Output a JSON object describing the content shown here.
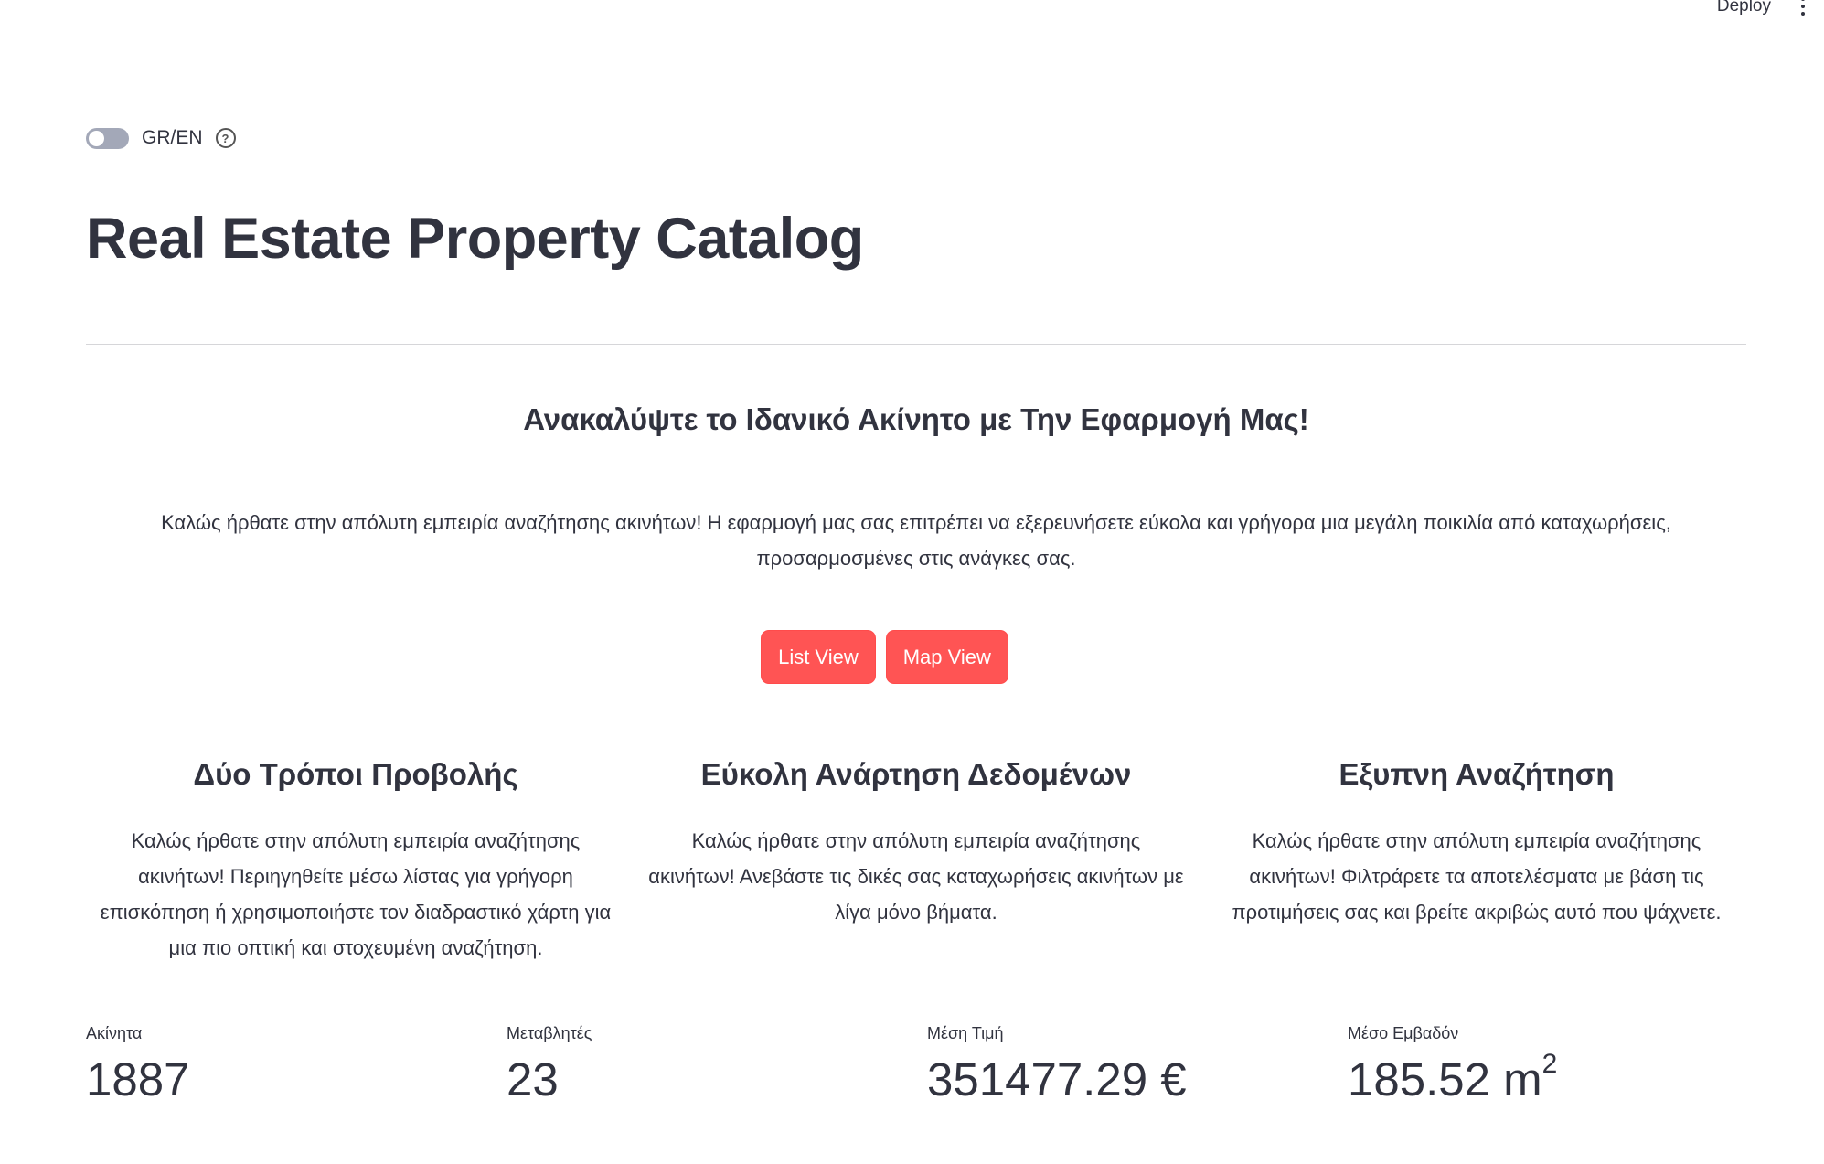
{
  "header": {
    "deploy_label": "Deploy",
    "menu_icon": "kebab-menu-icon"
  },
  "lang_toggle": {
    "label": "GR/EN",
    "checked": false,
    "help_icon": "question-circle-icon"
  },
  "page": {
    "title": "Real Estate Property Catalog"
  },
  "intro": {
    "subtitle": "Ανακαλύψτε το Ιδανικό Ακίνητο με Την Εφαρμογή Μας!",
    "text": "Καλώς ήρθατε στην απόλυτη εμπειρία αναζήτησης ακινήτων! Η εφαρμογή μας σας επιτρέπει να εξερευνήσετε εύκολα και γρήγορα μια μεγάλη ποικιλία από καταχωρήσεις, προσαρμοσμένες στις ανάγκες σας."
  },
  "buttons": {
    "list_view": "List View",
    "map_view": "Map View",
    "color": "#ff5454"
  },
  "features": [
    {
      "title": "Δύο Τρόποι Προβολής",
      "text": "Καλώς ήρθατε στην απόλυτη εμπειρία αναζήτησης ακινήτων! Περιηγηθείτε μέσω λίστας για γρήγορη επισκόπηση ή χρησιμοποιήστε τον διαδραστικό χάρτη για μια πιο οπτική και στοχευμένη αναζήτηση."
    },
    {
      "title": "Εύκολη Ανάρτηση Δεδομένων",
      "text": "Καλώς ήρθατε στην απόλυτη εμπειρία αναζήτησης ακινήτων! Ανεβάστε τις δικές σας καταχωρήσεις ακινήτων με λίγα μόνο βήματα."
    },
    {
      "title": "Εξυπνη Αναζήτηση",
      "text": "Καλώς ήρθατε στην απόλυτη εμπειρία αναζήτησης ακινήτων! Φιλτράρετε τα αποτελέσματα με βάση τις προτιμήσεις σας και βρείτε ακριβώς αυτό που ψάχνετε."
    }
  ],
  "metrics": [
    {
      "label": "Ακίνητα",
      "value": "1887"
    },
    {
      "label": "Μεταβλητές",
      "value": "23"
    },
    {
      "label": "Μέση Τιμή",
      "value": "351477.29 €"
    },
    {
      "label": "Μέσο Εμβαδόν",
      "value": "185.52 m",
      "superscript": "2"
    }
  ]
}
